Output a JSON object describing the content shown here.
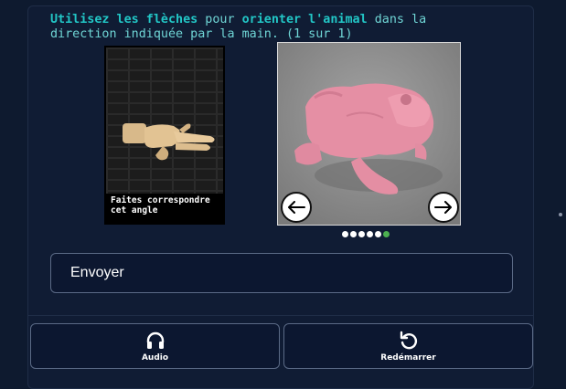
{
  "instruction": {
    "part1": "Utilisez les flèches",
    "part2": " pour ",
    "part3": "orienter l'animal",
    "part4": " dans la direction indiquée par la main. (1 sur 1)"
  },
  "reference": {
    "caption": "Faites correspondre cet angle",
    "icon": "pointing-hand"
  },
  "animal_viewer": {
    "icon_left": "arrow-left-icon",
    "icon_right": "arrow-right-icon",
    "dots_total": 6,
    "active_dot_index": 5,
    "animal": "pink toad"
  },
  "submit": {
    "label": "Envoyer"
  },
  "tools": {
    "audio_label": "Audio",
    "restart_label": "Redémarrer"
  },
  "colors": {
    "background": "#0e1a2f",
    "accent_text": "#22c6c6",
    "active_dot": "#4caf50"
  }
}
